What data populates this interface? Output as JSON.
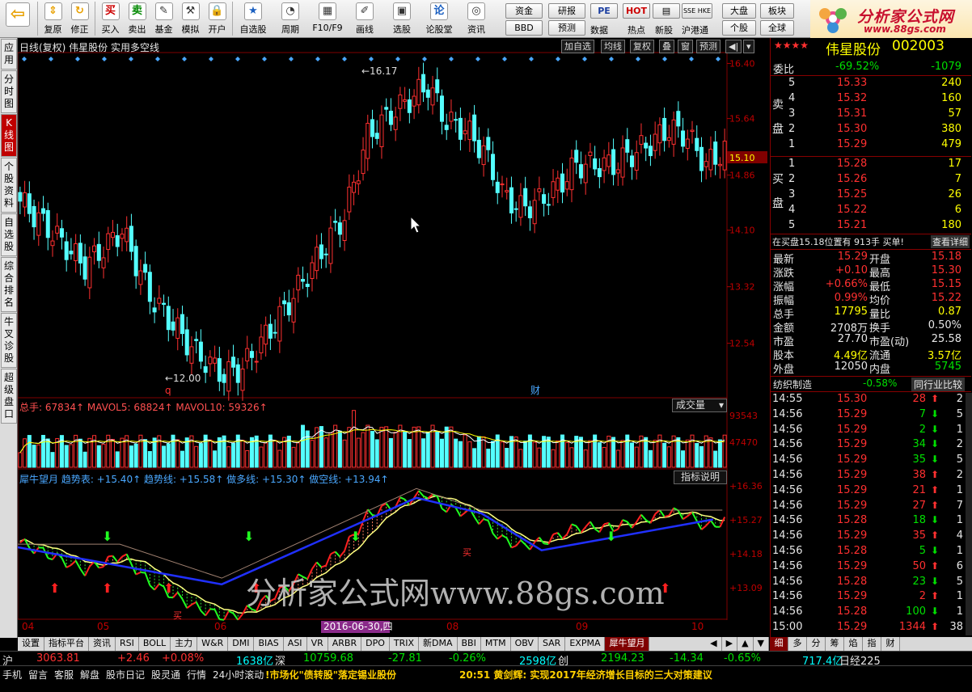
{
  "toolbar": {
    "items": [
      {
        "icon": "back-arrow",
        "label": ""
      },
      {
        "icon": "up-down-arrows",
        "label": "复原"
      },
      {
        "icon": "refresh",
        "label": "修正"
      },
      {
        "icon": "buy",
        "label": "买入"
      },
      {
        "icon": "sell",
        "label": "卖出"
      },
      {
        "icon": "fund",
        "label": "基金"
      },
      {
        "icon": "hammer",
        "label": "模拟"
      },
      {
        "icon": "lock",
        "label": "开户"
      },
      {
        "icon": "star",
        "label": "自选股"
      },
      {
        "icon": "clock",
        "label": "周期"
      },
      {
        "icon": "f10",
        "label": "F10/F9"
      },
      {
        "icon": "pen",
        "label": "画线"
      },
      {
        "icon": "screen",
        "label": "选股"
      },
      {
        "icon": "forum",
        "label": "论股堂"
      },
      {
        "icon": "news",
        "label": "资讯"
      }
    ],
    "small_buttons": [
      "资金",
      "BBD",
      "研报",
      "预测",
      "数据",
      "热点",
      "新股",
      "沪港通",
      "大盘",
      "板块",
      "个股",
      "全球"
    ],
    "small_labels_top": [
      "PE",
      "HOT",
      "SSE HKE"
    ]
  },
  "logo": {
    "text": "分析家公式网",
    "url": "www.88gs.com"
  },
  "left_tabs": [
    "应用",
    "分时图",
    "K线图",
    "个股资料",
    "自选股",
    "综合排名",
    "牛叉诊股",
    "超级盘口"
  ],
  "chart": {
    "header": "日线(复权)  伟星股份  实用多空线",
    "mini_buttons": [
      "加自选",
      "均线",
      "复权",
      "叠",
      "窗",
      "预测"
    ],
    "price_ticks": [
      "16.40",
      "15.64",
      "14.86",
      "14.10",
      "13.32",
      "12.54"
    ],
    "current_price": "15.10",
    "high_label": "16.17",
    "low_label": "12.00",
    "q_marker": "q",
    "cai_marker": "财",
    "volume_header": "总手: 67834↑  MAVOL5: 68824↑  MAVOL10: 59326↑",
    "volume_dropdown": "成交量",
    "volume_ticks": [
      "93543",
      "47470"
    ],
    "ind_header": "犀牛望月  趋势表: +15.40↑  趋势线: +15.58↑  做多线: +15.30↑  做空线: +13.94↑",
    "ind_button": "指标说明",
    "ind_ticks": [
      "+16.36",
      "+15.27",
      "+14.18",
      "+13.09"
    ],
    "date_labels": [
      "04",
      "05",
      "06",
      "08",
      "09",
      "10"
    ],
    "cursor_date": "2016-06-30,四",
    "watermark": "分析家公式网www.88gs.com",
    "buy_mark": "买"
  },
  "bottom_tabs": [
    "设置",
    "指标平台",
    "资讯",
    "RSI",
    "BOLL",
    "主力",
    "W&R",
    "DMI",
    "BIAS",
    "ASI",
    "VR",
    "ARBR",
    "DPO",
    "TRIX",
    "新DMA",
    "BBI",
    "MTM",
    "OBV",
    "SAR",
    "EXPMA",
    "犀牛望月"
  ],
  "right_tabs": [
    "细",
    "多",
    "分",
    "筹",
    "焰",
    "指",
    "财"
  ],
  "quote": {
    "stars": "★★★★",
    "name": "伟星股份",
    "code": "002003",
    "weibi_label": "委比",
    "weibi_pct": "-69.52%",
    "weibi_diff": "-1079",
    "sell_label": "卖盘",
    "buy_label": "买盘",
    "asks": [
      {
        "n": "5",
        "p": "15.33",
        "v": "240"
      },
      {
        "n": "4",
        "p": "15.32",
        "v": "160"
      },
      {
        "n": "3",
        "p": "15.31",
        "v": "57"
      },
      {
        "n": "2",
        "p": "15.30",
        "v": "380"
      },
      {
        "n": "1",
        "p": "15.29",
        "v": "479"
      }
    ],
    "bids": [
      {
        "n": "1",
        "p": "15.28",
        "v": "17"
      },
      {
        "n": "2",
        "p": "15.26",
        "v": "7"
      },
      {
        "n": "3",
        "p": "15.25",
        "v": "26"
      },
      {
        "n": "4",
        "p": "15.22",
        "v": "6"
      },
      {
        "n": "5",
        "p": "15.21",
        "v": "180"
      }
    ],
    "notice": "在买盘15.18位置有  913手  买单!",
    "notice_link": "查看详细",
    "stats": [
      [
        "最新",
        "15.29",
        "开盘",
        "15.18"
      ],
      [
        "涨跌",
        "+0.10",
        "最高",
        "15.30"
      ],
      [
        "涨幅",
        "+0.66%",
        "最低",
        "15.15"
      ],
      [
        "振幅",
        "0.99%",
        "均价",
        "15.22"
      ],
      [
        "总手",
        "17795",
        "量比",
        "0.87"
      ],
      [
        "金额",
        "2708万",
        "换手",
        "0.50%"
      ],
      [
        "市盈",
        "27.70",
        "市盈(动)",
        "25.58"
      ],
      [
        "股本",
        "4.49亿",
        "流通",
        "3.57亿"
      ],
      [
        "外盘",
        "12050",
        "内盘",
        "5745"
      ]
    ],
    "industry": "纺织制造",
    "industry_pct": "-0.58%",
    "industry_btn": "同行业比较",
    "ticks": [
      [
        "14:55",
        "15.30",
        "28",
        "up",
        "2"
      ],
      [
        "14:56",
        "15.29",
        "7",
        "down",
        "5"
      ],
      [
        "14:56",
        "15.29",
        "2",
        "down",
        "1"
      ],
      [
        "14:56",
        "15.29",
        "34",
        "down",
        "2"
      ],
      [
        "14:56",
        "15.29",
        "35",
        "down",
        "5"
      ],
      [
        "14:56",
        "15.29",
        "38",
        "up",
        "2"
      ],
      [
        "14:56",
        "15.29",
        "21",
        "up",
        "1"
      ],
      [
        "14:56",
        "15.29",
        "27",
        "up",
        "7"
      ],
      [
        "14:56",
        "15.28",
        "18",
        "down",
        "1"
      ],
      [
        "14:56",
        "15.29",
        "35",
        "up",
        "4"
      ],
      [
        "14:56",
        "15.28",
        "5",
        "down",
        "1"
      ],
      [
        "14:56",
        "15.29",
        "50",
        "up",
        "6"
      ],
      [
        "14:56",
        "15.28",
        "23",
        "down",
        "5"
      ],
      [
        "14:56",
        "15.29",
        "2",
        "up",
        "1"
      ],
      [
        "14:56",
        "15.28",
        "100",
        "down",
        "1"
      ],
      [
        "15:00",
        "15.29",
        "1344",
        "up",
        "38"
      ]
    ]
  },
  "status": {
    "sh_label": "沪",
    "sh_index": "3063.81",
    "sh_chg": "+2.46",
    "sh_pct": "+0.08%",
    "sh_amt": "1638亿",
    "sz_label": "深",
    "sz_index": "10759.68",
    "sz_chg": "-27.81",
    "sz_pct": "-0.26%",
    "sz_amt": "2598亿",
    "cy_label": "创",
    "cy_index": "2194.23",
    "cy_chg": "-14.34",
    "cy_pct": "-0.65%",
    "cy_amt": "717.4亿",
    "nk_label": "日经225",
    "menu": [
      "手机",
      "留言",
      "客服",
      "解盘",
      "股市日记",
      "股灵通",
      "行情",
      "24小时滚动"
    ],
    "ticker1": "!市场化\"债转股\"落定锡业股份",
    "ticker2": "20:51 黄剑辉: 实现2017年经济增长目标的三大对策建议"
  },
  "colors": {
    "up": "#ff3030",
    "down": "#00ffff",
    "accent": "#c00000",
    "ma_blue": "#2030ff",
    "trend_yellow": "#ffff80"
  }
}
